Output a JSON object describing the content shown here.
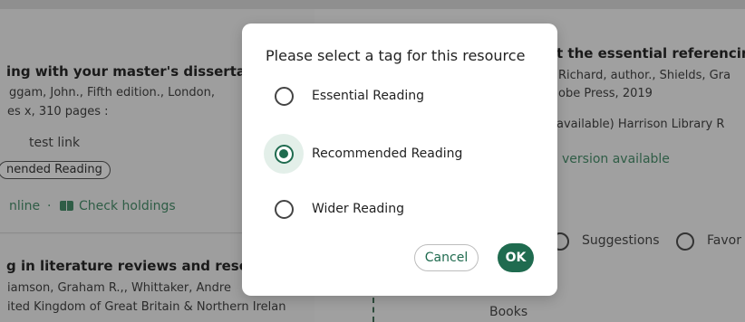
{
  "background": {
    "left_card1": {
      "title": "ing with your master's dissertati",
      "meta_line1": "ggam, John., Fifth edition., London,",
      "meta_line2": "es x, 310 pages :",
      "link": "test link",
      "tag_pill": "nended Reading",
      "online": "nline",
      "separator": "·",
      "check_holdings": "Check holdings"
    },
    "left_card2": {
      "title": "g in literature reviews and resea",
      "meta_line1": "iamson, Graham R.,, Whittaker, Andre",
      "meta_line2": "ited Kingdom of Great Britain & Northern Irelan"
    },
    "right_card": {
      "title": "t the essential referencin",
      "meta_line1": "Richard, author., Shields, Gra",
      "meta_line2": "obe Press, 2019",
      "availability": "available) Harrison Library R",
      "version": "version available"
    },
    "right_filters": {
      "suggestions": "Suggestions",
      "favourites": "Favor"
    },
    "books_label": "Books"
  },
  "modal": {
    "title": "Please select a tag for this resource",
    "options": [
      {
        "label": "Essential Reading",
        "selected": false
      },
      {
        "label": "Recommended Reading",
        "selected": true
      },
      {
        "label": "Wider Reading",
        "selected": false
      }
    ],
    "cancel_label": "Cancel",
    "ok_label": "OK"
  },
  "colors": {
    "accent": "#1f6b4f",
    "selected_halo": "#e3efe9",
    "overlay": "#9c9c9c"
  }
}
